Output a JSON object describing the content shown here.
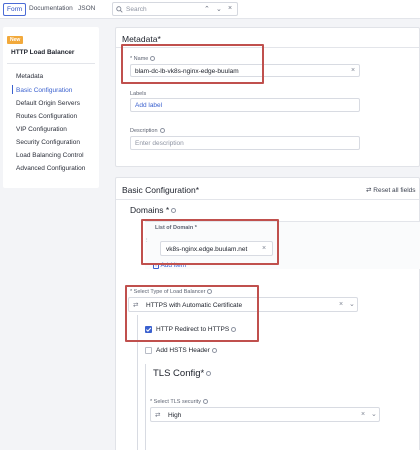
{
  "tabs": {
    "form": "Form",
    "documentation": "Documentation",
    "json": "JSON"
  },
  "search": {
    "placeholder": "Search"
  },
  "sidebar": {
    "badge": "New",
    "title": "HTTP Load Balancer",
    "items": [
      {
        "label": "Metadata"
      },
      {
        "label": "Basic Configuration"
      },
      {
        "label": "Default Origin Servers"
      },
      {
        "label": "Routes Configuration"
      },
      {
        "label": "VIP Configuration"
      },
      {
        "label": "Security Configuration"
      },
      {
        "label": "Load Balancing Control"
      },
      {
        "label": "Advanced Configuration"
      }
    ]
  },
  "metadata": {
    "heading": "Metadata",
    "required_mark": "*",
    "name_label": "* Name",
    "name_value": "blam-dc-lb-vk8s-nginx-edge-buulam",
    "labels_label": "Labels",
    "add_label": "Add label",
    "description_label": "Description",
    "description_placeholder": "Enter description"
  },
  "basic": {
    "heading": "Basic Configuration",
    "required_mark": "*",
    "reset": "Reset all fields",
    "domains_heading": "Domains",
    "domains_mark": "*",
    "list_label": "List of Domain *",
    "domain_value": "vk8s-nginx.edge.buulam.net",
    "add_item": "Add item",
    "lb_type_label": "* Select Type of Load Balancer",
    "lb_type_value": "HTTPS with Automatic Certificate",
    "http_redirect": "HTTP Redirect to HTTPS",
    "hsts": "Add HSTS Header",
    "tls_heading": "TLS Config",
    "tls_mark": "*",
    "tls_security_label": "* Select TLS security",
    "tls_security_value": "High"
  },
  "colors": {
    "accent": "#3b61cf",
    "highlight_box": "#c0504d",
    "badge": "#f2a93b"
  }
}
